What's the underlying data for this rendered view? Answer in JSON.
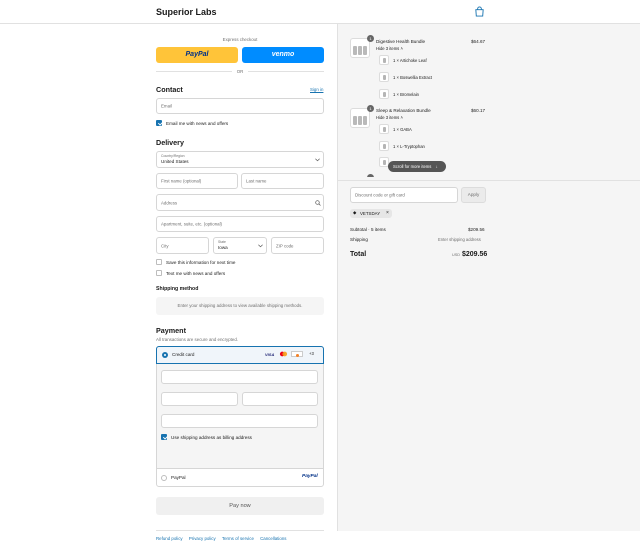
{
  "header": {
    "brand": "Superior Labs"
  },
  "express": {
    "title": "Express checkout",
    "paypal": "PayPal",
    "venmo": "venmo",
    "or": "OR"
  },
  "contact": {
    "heading": "Contact",
    "sign_in": "Sign in",
    "email_placeholder": "Email",
    "news_label": "Email me with news and offers"
  },
  "delivery": {
    "heading": "Delivery",
    "country_label": "Country/Region",
    "country_value": "United States",
    "first_name": "First name (optional)",
    "last_name": "Last name",
    "address": "Address",
    "apartment": "Apartment, suite, etc. (optional)",
    "city": "City",
    "state_label": "State",
    "state_value": "Iowa",
    "zip": "ZIP code",
    "save_info": "Save this information for next time",
    "text_news": "Text me with news and offers"
  },
  "shipping": {
    "heading": "Shipping method",
    "note": "Enter your shipping address to view available shipping methods."
  },
  "payment": {
    "heading": "Payment",
    "secure_note": "All transactions are secure and encrypted.",
    "credit_card": "Credit card",
    "visa": "VISA",
    "more": "+3",
    "billing_label": "Use shipping address as billing address",
    "paypal": "PayPal",
    "paypal_logo": "PayPal"
  },
  "pay_now": "Pay now",
  "footer": [
    "Refund policy",
    "Privacy policy",
    "Terms of service",
    "Cancellations"
  ],
  "cart": {
    "products": [
      {
        "name": "Digestive Health Bundle",
        "qty": "1",
        "price": "$64.67",
        "hide": "Hide 3 items",
        "items": [
          "1 × Artichoke Leaf",
          "1 × Boswellia Extract",
          "1 × Bromelain"
        ]
      },
      {
        "name": "Sleep & Relaxation Bundle",
        "qty": "1",
        "price": "$60.17",
        "hide": "Hide 3 items",
        "items": [
          "1 × GABA",
          "1 × L-Tryptophan"
        ]
      }
    ],
    "scroll_hint": "Scroll for more items",
    "discount_placeholder": "Discount code or gift card",
    "apply": "Apply",
    "code": "VETSDAY",
    "subtotal_label": "Subtotal · 5 items",
    "subtotal_value": "$209.56",
    "shipping_label": "Shipping",
    "shipping_value": "Enter shipping address",
    "total_label": "Total",
    "currency": "USD",
    "total_value": "$209.56"
  },
  "colors": {
    "paypal_yellow": "#ffc439",
    "venmo_blue": "#008cff",
    "accent": "#1773b0"
  }
}
